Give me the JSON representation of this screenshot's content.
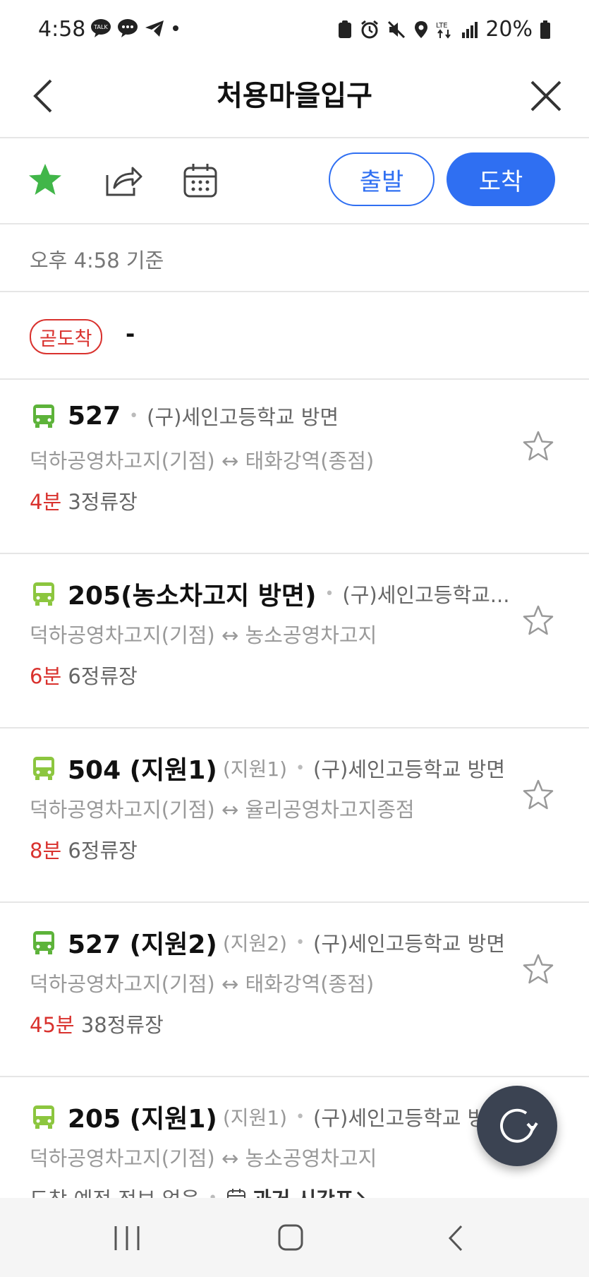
{
  "status_bar": {
    "time": "4:58",
    "battery_pct": "20%",
    "network": "LTE"
  },
  "header": {
    "title": "처용마을입구"
  },
  "actions": {
    "depart_label": "출발",
    "arrive_label": "도착"
  },
  "basis_text": "오후 4:58 기준",
  "soon_arriving": {
    "badge": "곧도착",
    "value": "-"
  },
  "routes": [
    {
      "number": "527",
      "sub": "",
      "direction": "(구)세인고등학교 방면",
      "path": "덕하공영차고지(기점) ↔ 태화강역(종점)",
      "eta_min": "4분",
      "eta_stops": "3정류장"
    },
    {
      "number": "205(농소차고지 방면)",
      "sub": "",
      "direction": "(구)세인고등학교...",
      "path": "덕하공영차고지(기점) ↔ 농소공영차고지",
      "eta_min": "6분",
      "eta_stops": "6정류장"
    },
    {
      "number": "504 (지원1)",
      "sub": "(지원1)",
      "direction": "(구)세인고등학교 방면",
      "path": "덕하공영차고지(기점) ↔ 율리공영차고지종점",
      "eta_min": "8분",
      "eta_stops": "6정류장"
    },
    {
      "number": "527 (지원2)",
      "sub": "(지원2)",
      "direction": "(구)세인고등학교 방면",
      "path": "덕하공영차고지(기점) ↔ 태화강역(종점)",
      "eta_min": "45분",
      "eta_stops": "38정류장"
    },
    {
      "number": "205 (지원1)",
      "sub": "(지원1)",
      "direction": "(구)세인고등학교 방면",
      "path": "덕하공영차고지(기점) ↔ 농소공영차고지",
      "no_info": "도착 예정 정보 없음",
      "timetable_label": "과거 시간표"
    }
  ],
  "colors": {
    "accent": "#2f6ff2",
    "alert": "#d9322e",
    "bus_green": "#5db33a",
    "favorite_green": "#41b649"
  }
}
